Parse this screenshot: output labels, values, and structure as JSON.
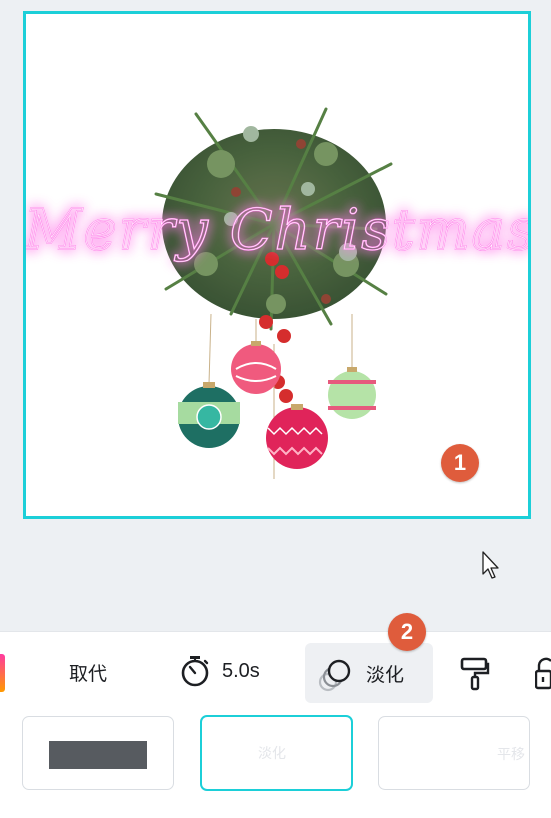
{
  "design": {
    "greeting_text": "Merry Christmas",
    "frame_color": "#1ccfd8",
    "neon_color": "#ff7ce9"
  },
  "badges": {
    "first": "1",
    "second": "2"
  },
  "toolbar": {
    "color_swatch_icon": "gradient-swatch-icon",
    "replace_label": "取代",
    "timer_icon": "stopwatch-icon",
    "duration_label": "5.0s",
    "fade_icon": "fade-circles-icon",
    "fade_label": "淡化",
    "brush_icon": "paint-roller-icon",
    "lock_icon": "unlock-icon"
  },
  "animation_options": {
    "fade_label": "淡化",
    "pan_label": "平移",
    "selected": "淡化"
  }
}
